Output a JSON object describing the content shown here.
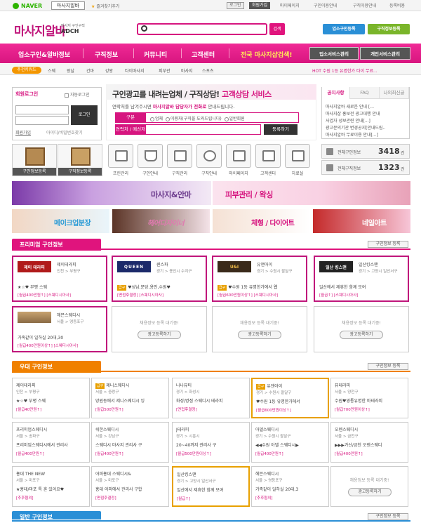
{
  "topbar": {
    "naver": "NAVER",
    "masaji_tab": "마사지알바",
    "favorite": "즐겨찾기추가",
    "links": [
      "로그인",
      "회원가입",
      "마이페이지",
      "구인이용안내",
      "구직이용안내",
      "등록비용"
    ]
  },
  "header": {
    "logo": "마사지알바",
    "logo_sub": "마사지 구인구직",
    "logo_sub2": "ADCH",
    "search_btn": "검색",
    "btn_company": "업소구인등록",
    "btn_resume": "구직정보등록"
  },
  "nav": {
    "items": [
      "업소구인&알바정보",
      "구직정보",
      "커뮤니티",
      "고객센터",
      "전국 마사지샵검색!"
    ],
    "mgmt1": "업소서비스관리",
    "mgmt2": "개인서비스관리"
  },
  "subnav": {
    "pill": "추천키워드",
    "items": [
      "스웨",
      "왕날",
      "건마",
      "강왕",
      "타이마사지",
      "피부관",
      "마사지",
      "스포츠"
    ],
    "ticker": "HOT 수원 1등 유명한가 타이 무료..."
  },
  "login": {
    "title": "회원로그인",
    "auto": "자동로그인",
    "btn": "로그인",
    "join": "회원가입",
    "find": "아이디/비밀번호찾기"
  },
  "hero": {
    "title_a": "구인광고를 내려는업체 / 구직상담! ",
    "title_b": "고객상담 서비스",
    "sub_a": "연락처를 남겨주시면 ",
    "sub_b": "마사지알바 담당자가 전화로",
    "sub_c": " 안내드립니다.",
    "lbl_type": "구분",
    "opts": [
      "업체",
      "이용자(구직을 도와드립니다)",
      "일반회원"
    ],
    "lbl_contact": "연락처 / 메신저",
    "reg_btn": "등록하기"
  },
  "notice": {
    "tabs": [
      "공지사항",
      "FAQ",
      "나의최신글"
    ],
    "lines": [
      "마사지알바 새로운 안내 [...",
      "마사지샵 홍보전 광고대행 안내",
      "사업자 성보관련 안내[...]",
      "광고문의기관 변경공지[안내드림..",
      "마사지알바 무료이용 안내[...]"
    ]
  },
  "quick": {
    "big1": "구인정보등록",
    "big2": "구직정보등록",
    "icons": [
      "프린관리",
      "구인안내",
      "구직관리",
      "구직안내",
      "마이페이지",
      "고객센터",
      "자료실"
    ]
  },
  "stats": [
    {
      "label": "전체구인정보",
      "num": "3418",
      "unit": "건"
    },
    {
      "label": "전체구직정보",
      "num": "1323",
      "unit": "건"
    }
  ],
  "banners": [
    "마사지&안마",
    "피부관리 / 왁싱",
    "메이크업분장",
    "헤어디자이너",
    "체형 / 다이어트",
    "네일아트"
  ],
  "premium": {
    "title": "프리미엄 구인정보",
    "more": "구인정보 등록",
    "cards": [
      {
        "logo": "제이 테라피",
        "name": "제이테라피",
        "loc": "인천 > 부평구",
        "desc": "★☆♥ 부평 스웨",
        "pay": "[월급400만원↑] [스웨디시아사]"
      },
      {
        "logo": "QUEEN",
        "name": "퀸스파",
        "loc": "경기 > 용인시 수지구",
        "desc": "♥성남,분당,용인,수원♥",
        "pay": "[면접후결정] [스웨디시아사]"
      },
      {
        "logo": "U&I",
        "name": "유앤아이",
        "loc": "경기 > 수원시 팔달구",
        "desc": "♥수원 1등 유명한가에서 웹",
        "pay": "[월급600만원이상↑] [스웨디시아사]"
      },
      {
        "logo": "일산 킹스맨",
        "name": "일산킹스맨",
        "loc": "경기 > 고양시 일산서구",
        "desc": "일산에서 제휴한 함께 모여",
        "pay": "[월급↑] [스웨디시아사]"
      },
      {
        "logo": "",
        "name": "헤븐스웨디시",
        "loc": "서울 > 영등포구",
        "desc": "가족같이 일하실 20대,30",
        "pay": "[월급400만원이상↑] [스웨디시아사]"
      }
    ],
    "wait": "채용정보 등록 대기중!",
    "wait_btn": "광고등록하기"
  },
  "excellent": {
    "title": "우대 구인정보",
    "more": "구인정보 등록",
    "cards": [
      {
        "name": "제이테라피",
        "loc": "인천 > 부평구",
        "desc": "★☆♥ 부평 스웨",
        "pay": "[월급40만원↑]",
        "badge": ""
      },
      {
        "name": "제니스웨디시",
        "loc": "서울 > 중랑구",
        "desc": "망원동에서 제니스웨디시 잉",
        "pay": "[월급500만원↑]",
        "badge": "급구"
      },
      {
        "name": "나나뷰티",
        "loc": "경기 > 화성시",
        "desc": "화성/병점 스웨디시 테라피",
        "pay": "[면접후결정]",
        "badge": ""
      },
      {
        "name": "유앤아이",
        "loc": "경기 > 수원시 팔달구",
        "desc": "♥수원 1등 유명한가에서",
        "pay": "[월급600만원이상↑]",
        "badge": "급구"
      },
      {
        "name": "뷰테라피",
        "loc": "서울 > 양천구",
        "desc": "수원♥영통유명한 마테라피",
        "pay": "[월급700만원이상↑]",
        "badge": ""
      },
      {
        "name": "프리미엄스웨디시",
        "loc": "서울 > 송파구",
        "desc": "프리미엄스웨디시에서 관리사",
        "pay": "[월급400만원↑]",
        "badge": ""
      },
      {
        "name": "쉬한스웨디시",
        "loc": "서울 > 강남구",
        "desc": "스웨디시 마사지 관리사 구",
        "pay": "[월급400만원↑]",
        "badge": ""
      },
      {
        "name": "J테라피",
        "loc": "경기 > 시흥시",
        "desc": "20~40까지 관리사 구",
        "pay": "[월급500만원이상↑]",
        "badge": ""
      },
      {
        "name": "아델스웨디시",
        "loc": "경기 > 수원시 팔달구",
        "desc": "◀◀수원 아델 스웨디시▶",
        "pay": "[월급400만원↑]",
        "badge": ""
      },
      {
        "name": "오렌스웨디시",
        "loc": "서울 > 금천구",
        "desc": "▶▶▶가산/금천 오렌스웨디",
        "pay": "[월급400만원↑]",
        "badge": ""
      },
      {
        "name": "홍대 THE NEW",
        "loc": "서울 > 마포구",
        "desc": "★홍대/마포 특 혼 있어요♥",
        "pay": "[추후협의]",
        "badge": ""
      },
      {
        "name": "어퍼홍대 스웨디시&",
        "loc": "서울 > 마포구",
        "desc": "홍대 어퍼에서 관리사 구합",
        "pay": "[면접후결정]",
        "badge": ""
      },
      {
        "name": "일산킹스맨",
        "loc": "경기 > 고양시 일산서구",
        "desc": "일산에서 제휴한 함께 모여",
        "pay": "[월급↑]",
        "badge": ""
      },
      {
        "name": "헤븐스웨디시",
        "loc": "서울 > 영등포구",
        "desc": "가족같이 일하실 20대,3",
        "pay": "[추후협의]",
        "badge": ""
      }
    ],
    "wait": "채용정보 등록 대기중!",
    "wait_btn": "광고등록하기"
  },
  "general": {
    "title": "일반 구인정보",
    "more": "구인정보 등록"
  },
  "colors": {
    "pink": "#d6157f",
    "orange": "#f08000",
    "blue": "#2a8fd6"
  }
}
